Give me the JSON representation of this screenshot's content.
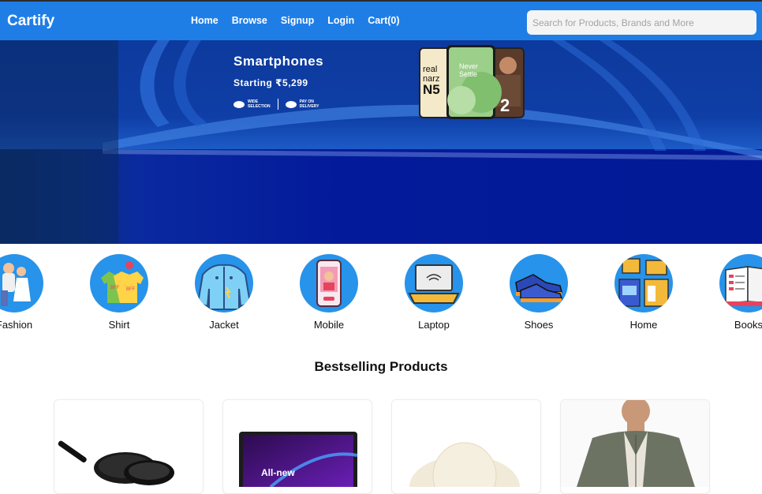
{
  "brand": "Cartify",
  "nav": {
    "links": [
      "Home",
      "Browse",
      "Signup",
      "Login",
      "Cart(0)"
    ],
    "search_placeholder": "Search for Products, Brands and More"
  },
  "hero": {
    "title": "Smartphones",
    "subtitle": "Starting ₹5,299",
    "badge1_line1": "Wide",
    "badge1_line2": "Selection",
    "badge2_line1": "Pay on",
    "badge2_line2": "Delivery",
    "phone1_text_a": "real",
    "phone1_text_b": "narz",
    "phone1_text_c": "N5",
    "phone2_text_a": "Never",
    "phone2_text_b": "Settle",
    "phone3_text": "2"
  },
  "categories": [
    {
      "label": "Fashion",
      "icon": "fashion-icon"
    },
    {
      "label": "Shirt",
      "icon": "shirt-icon"
    },
    {
      "label": "Jacket",
      "icon": "jacket-icon"
    },
    {
      "label": "Mobile",
      "icon": "mobile-icon"
    },
    {
      "label": "Laptop",
      "icon": "laptop-icon"
    },
    {
      "label": "Shoes",
      "icon": "shoes-icon"
    },
    {
      "label": "Home",
      "icon": "home-appliance-icon"
    },
    {
      "label": "Books",
      "icon": "books-icon"
    }
  ],
  "bestselling": {
    "title": "Bestselling Products",
    "products": [
      {
        "image": "cookware-pans"
      },
      {
        "image": "laptop-all-new",
        "caption": "All-new"
      },
      {
        "image": "straw-hat"
      },
      {
        "image": "man-shirt"
      }
    ]
  },
  "colors": {
    "navbar": "#1f7ee6",
    "hero_bg": "#031a9a",
    "category_circle": "#2793ea"
  }
}
